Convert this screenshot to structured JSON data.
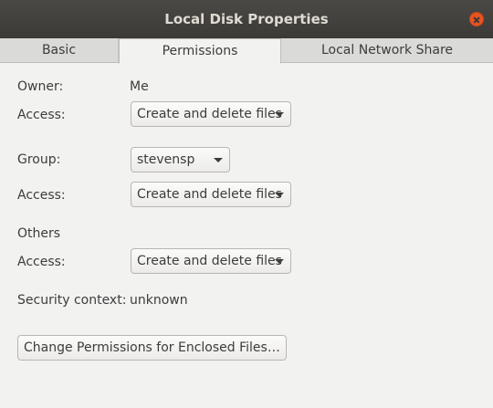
{
  "window": {
    "title": "Local Disk Properties"
  },
  "tabs": [
    {
      "label": "Basic"
    },
    {
      "label": "Permissions"
    },
    {
      "label": "Local Network Share"
    }
  ],
  "permissions": {
    "owner_label": "Owner:",
    "owner_value": "Me",
    "owner_access_label": "Access:",
    "owner_access_value": "Create and delete files",
    "group_label": "Group:",
    "group_value": "stevensp",
    "group_access_label": "Access:",
    "group_access_value": "Create and delete files",
    "others_label": "Others",
    "others_access_label": "Access:",
    "others_access_value": "Create and delete files",
    "security_label": "Security context:",
    "security_value": "unknown",
    "enclosed_button_label": "Change Permissions for Enclosed Files…"
  },
  "colors": {
    "titlebar": "#3c3b37",
    "close_button": "#e95420",
    "background": "#f2f2f1"
  }
}
